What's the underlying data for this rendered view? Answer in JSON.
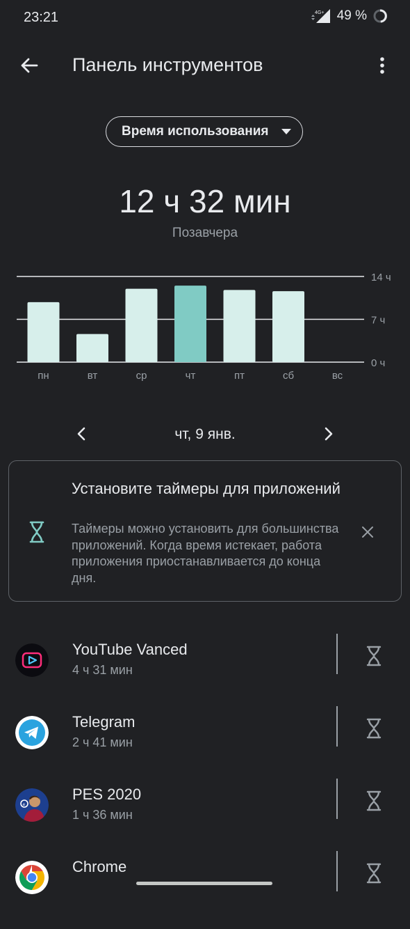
{
  "status_bar": {
    "time": "23:21",
    "network": "4G+",
    "battery": "49 %"
  },
  "app_bar": {
    "title": "Панель инструментов",
    "back_icon": "arrow-left-icon",
    "menu_icon": "more-vertical-icon"
  },
  "selector": {
    "label": "Время использования"
  },
  "summary": {
    "total": "12 ч 32 мин",
    "subtitle": "Позавчера"
  },
  "chart_data": {
    "type": "bar",
    "categories": [
      "пн",
      "вт",
      "ср",
      "чт",
      "пт",
      "сб",
      "вс"
    ],
    "values": [
      9.8,
      4.6,
      12.0,
      12.5,
      11.8,
      11.6,
      0
    ],
    "y_ticks": [
      "14 ч",
      "7 ч",
      "0 ч"
    ],
    "y_tick_values": [
      14,
      7,
      0
    ],
    "ylim": [
      0,
      14
    ],
    "highlight_index": 3,
    "colors": {
      "bar": "#d7efeb",
      "highlight": "#80cbc4",
      "grid": "#e8eaed",
      "label": "#9aa0a6"
    }
  },
  "date_nav": {
    "date": "чт, 9 янв.",
    "prev_icon": "chevron-left-icon",
    "next_icon": "chevron-right-icon"
  },
  "timer_card": {
    "title": "Установите таймеры для приложений",
    "body": "Таймеры можно установить для большинства приложений. Когда время истекает, работа приложения приостанавливается до конца дня.",
    "icon": "hourglass-icon",
    "accent": "#80cbc4"
  },
  "apps": [
    {
      "name": "YouTube Vanced",
      "time": "4 ч 31 мин",
      "icon": "youtube-vanced-icon"
    },
    {
      "name": "Telegram",
      "time": "2 ч 41 мин",
      "icon": "telegram-icon"
    },
    {
      "name": "PES 2020",
      "time": "1 ч 36 мин",
      "icon": "pes-2020-icon"
    },
    {
      "name": "Chrome",
      "time": "",
      "icon": "chrome-icon"
    }
  ]
}
